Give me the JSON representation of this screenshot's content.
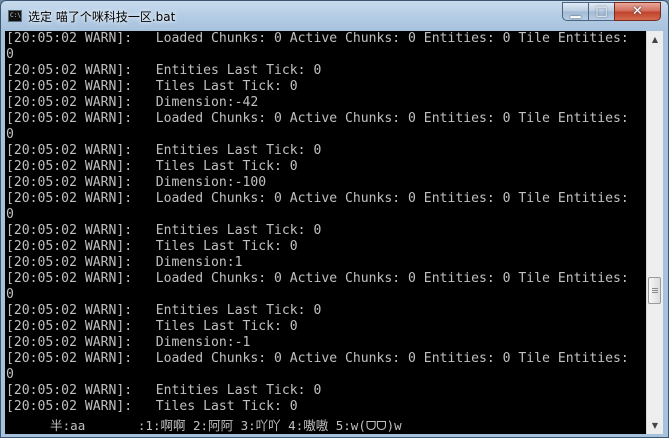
{
  "window": {
    "title": "选定 喵了个咪科技一区.bat",
    "minimize_glyph": "▁",
    "maximize_glyph": "□",
    "close_glyph": "✕"
  },
  "console": {
    "lines": [
      "[20:05:02 WARN]:   Loaded Chunks: 0 Active Chunks: 0 Entities: 0 Tile Entities:",
      "0",
      "[20:05:02 WARN]:   Entities Last Tick: 0",
      "[20:05:02 WARN]:   Tiles Last Tick: 0",
      "[20:05:02 WARN]:   Dimension:-42",
      "[20:05:02 WARN]:   Loaded Chunks: 0 Active Chunks: 0 Entities: 0 Tile Entities:",
      "0",
      "[20:05:02 WARN]:   Entities Last Tick: 0",
      "[20:05:02 WARN]:   Tiles Last Tick: 0",
      "[20:05:02 WARN]:   Dimension:-100",
      "[20:05:02 WARN]:   Loaded Chunks: 0 Active Chunks: 0 Entities: 0 Tile Entities:",
      "0",
      "[20:05:02 WARN]:   Entities Last Tick: 0",
      "[20:05:02 WARN]:   Tiles Last Tick: 0",
      "[20:05:02 WARN]:   Dimension:1",
      "[20:05:02 WARN]:   Loaded Chunks: 0 Active Chunks: 0 Entities: 0 Tile Entities:",
      "0",
      "[20:05:02 WARN]:   Entities Last Tick: 0",
      "[20:05:02 WARN]:   Tiles Last Tick: 0",
      "[20:05:02 WARN]:   Dimension:-1",
      "[20:05:02 WARN]:   Loaded Chunks: 0 Active Chunks: 0 Entities: 0 Tile Entities:",
      "0",
      "[20:05:02 WARN]:   Entities Last Tick: 0",
      "[20:05:02 WARN]:   Tiles Last Tick: 0"
    ],
    "ime_status": "      半:aa       :1:啊啊 2:阿阿 3:吖吖 4:嗷嗷 5:w(ᗜᗜ)w"
  },
  "scrollbar": {
    "up_glyph": "▲",
    "down_glyph": "▼",
    "position": 0.67
  },
  "colors": {
    "console_bg": "#000000",
    "console_text": "#c0c0c0",
    "titlebar": "#a7c2dd",
    "close_button": "#c0432c"
  }
}
